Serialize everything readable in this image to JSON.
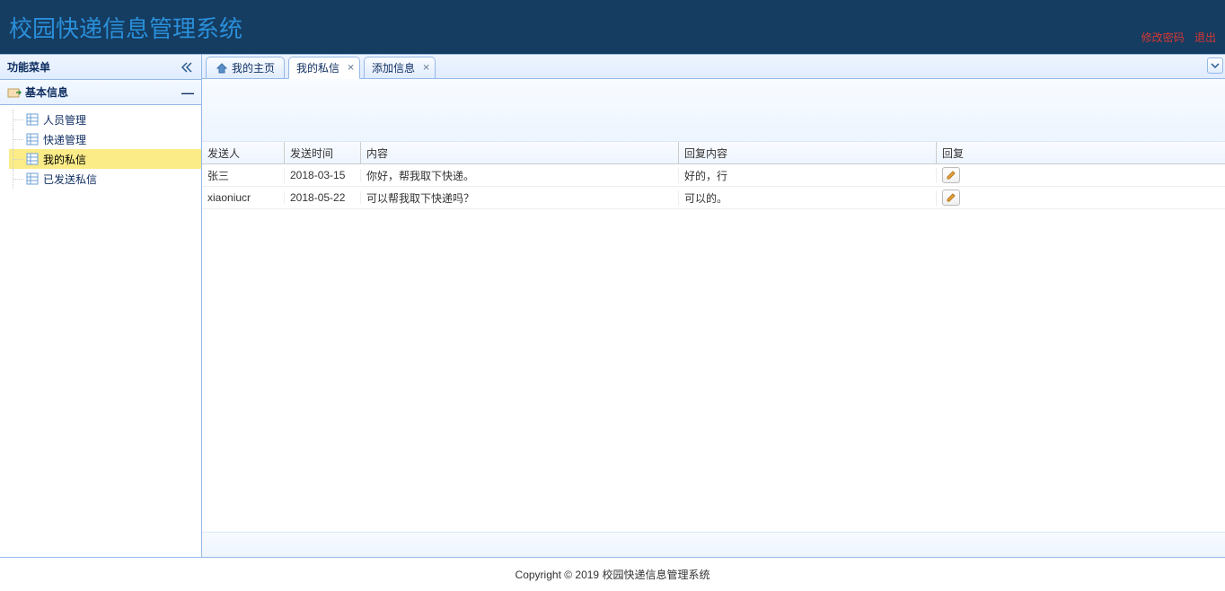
{
  "header": {
    "title": "校园快递信息管理系统",
    "change_password": "修改密码",
    "logout": "退出"
  },
  "sidebar": {
    "title": "功能菜单",
    "group": {
      "title": "基本信息",
      "items": [
        {
          "label": "人员管理"
        },
        {
          "label": "快递管理"
        },
        {
          "label": "我的私信"
        },
        {
          "label": "已发送私信"
        }
      ]
    }
  },
  "tabs": {
    "home": "我的主页",
    "messages": "我的私信",
    "add_info": "添加信息"
  },
  "grid": {
    "headers": {
      "sender": "发送人",
      "send_time": "发送时间",
      "content": "内容",
      "reply_content": "回复内容",
      "reply": "回复"
    },
    "rows": [
      {
        "sender": "张三",
        "send_time": "2018-03-15",
        "content": "你好，帮我取下快递。",
        "reply_content": "好的，行"
      },
      {
        "sender": "xiaoniucr",
        "send_time": "2018-05-22",
        "content": "可以帮我取下快递吗？",
        "reply_content": "可以的。"
      }
    ]
  },
  "footer": {
    "copyright": "Copyright © 2019 校园快递信息管理系统"
  }
}
